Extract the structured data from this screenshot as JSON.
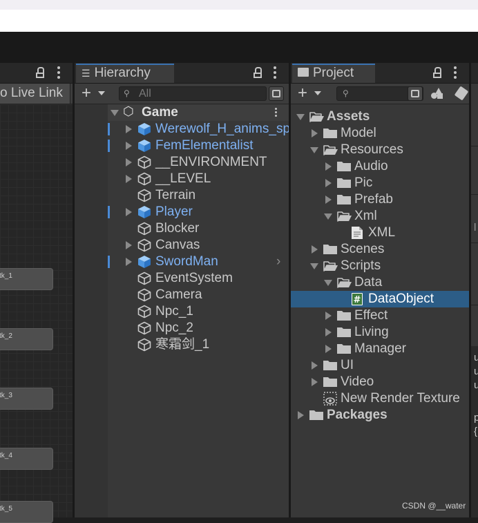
{
  "scene_view": {
    "live_link_label": "o Live Link",
    "nodes": [
      {
        "label": "tk_1"
      },
      {
        "label": "tk_2"
      },
      {
        "label": "tk_3"
      },
      {
        "label": "tk_4"
      },
      {
        "label": "tk_5"
      }
    ]
  },
  "hierarchy": {
    "tab_label": "Hierarchy",
    "search_placeholder": "All",
    "scene_name": "Game",
    "items": [
      {
        "label": "Werewolf_H_anims_sp",
        "prefab": true,
        "expandable": true
      },
      {
        "label": "FemElementalist",
        "prefab": true,
        "expandable": true
      },
      {
        "label": "__ENVIRONMENT",
        "prefab": false,
        "expandable": true
      },
      {
        "label": "__LEVEL",
        "prefab": false,
        "expandable": true
      },
      {
        "label": "Terrain",
        "prefab": false,
        "expandable": false
      },
      {
        "label": "Player",
        "prefab": true,
        "expandable": true
      },
      {
        "label": "Blocker",
        "prefab": false,
        "expandable": false
      },
      {
        "label": "Canvas",
        "prefab": false,
        "expandable": true
      },
      {
        "label": "SwordMan",
        "prefab": true,
        "expandable": true
      },
      {
        "label": "EventSystem",
        "prefab": false,
        "expandable": false
      },
      {
        "label": "Camera",
        "prefab": false,
        "expandable": false
      },
      {
        "label": "Npc_1",
        "prefab": false,
        "expandable": false
      },
      {
        "label": "Npc_2",
        "prefab": false,
        "expandable": false
      },
      {
        "label": "寒霜剑_1",
        "prefab": false,
        "expandable": false
      }
    ]
  },
  "project": {
    "tab_label": "Project",
    "tree": [
      {
        "label": "Assets",
        "depth": 0,
        "state": "open",
        "bold": true
      },
      {
        "label": "Model",
        "depth": 1,
        "state": "closed"
      },
      {
        "label": "Resources",
        "depth": 1,
        "state": "open"
      },
      {
        "label": "Audio",
        "depth": 2,
        "state": "closed"
      },
      {
        "label": "Pic",
        "depth": 2,
        "state": "closed"
      },
      {
        "label": "Prefab",
        "depth": 2,
        "state": "closed"
      },
      {
        "label": "Xml",
        "depth": 2,
        "state": "open"
      },
      {
        "label": "XML",
        "depth": 3,
        "state": "file"
      },
      {
        "label": "Scenes",
        "depth": 1,
        "state": "closed"
      },
      {
        "label": "Scripts",
        "depth": 1,
        "state": "open"
      },
      {
        "label": "Data",
        "depth": 2,
        "state": "open"
      },
      {
        "label": "DataObject",
        "depth": 3,
        "state": "script",
        "selected": true
      },
      {
        "label": "Effect",
        "depth": 2,
        "state": "closed"
      },
      {
        "label": "Living",
        "depth": 2,
        "state": "closed"
      },
      {
        "label": "Manager",
        "depth": 2,
        "state": "closed"
      },
      {
        "label": "UI",
        "depth": 1,
        "state": "closed"
      },
      {
        "label": "Video",
        "depth": 1,
        "state": "closed"
      },
      {
        "label": "New Render Texture",
        "depth": 1,
        "state": "texture"
      },
      {
        "label": "Packages",
        "depth": 0,
        "state": "closed",
        "bold": true
      }
    ]
  },
  "inspector_fragments": [
    "l",
    "u",
    "u",
    "u",
    "p",
    "{"
  ],
  "watermark": "CSDN @__water",
  "colors": {
    "accent": "#3a72b0",
    "prefab_blue": "#7eb1f2",
    "selection": "#2c5d87"
  }
}
